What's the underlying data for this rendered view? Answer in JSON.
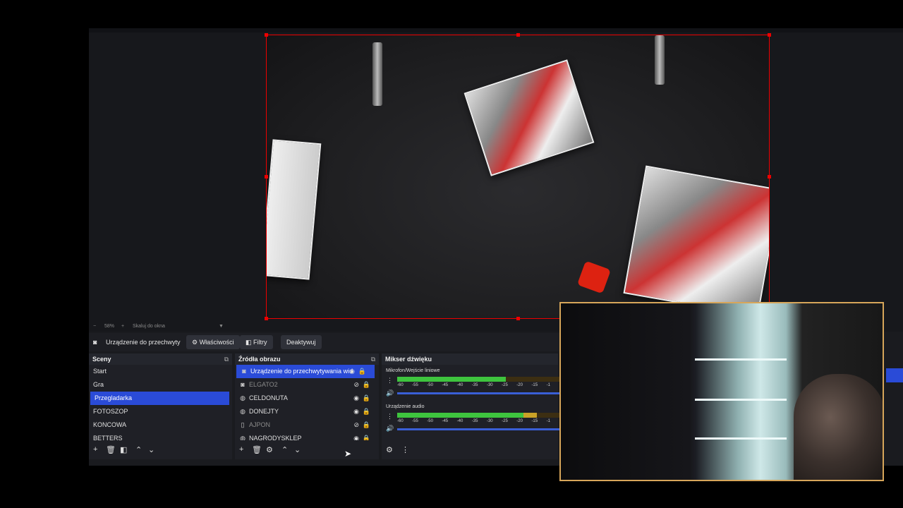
{
  "preview": {
    "zoom": "58%",
    "fit_label": "Skaluj do okna"
  },
  "source_toolbar": {
    "selected_source": "Urządzenie do przechwyty",
    "properties_label": "Właściwości",
    "filters_label": "Filtry",
    "deactivate_label": "Deaktywuj"
  },
  "scenes": {
    "title": "Sceny",
    "items": [
      "Start",
      "Gra",
      "Przegladarka",
      "FOTOSZOP",
      "KONCOWA",
      "BETTERS"
    ],
    "selected": "Przegladarka"
  },
  "sources": {
    "title": "Źródła obrazu",
    "items": [
      {
        "label": "Urządzenie do przechwytywania wid",
        "icon": "camera-icon",
        "visible": true,
        "selected": true
      },
      {
        "label": "ELGATO2",
        "icon": "camera-icon",
        "visible": false,
        "selected": false
      },
      {
        "label": "CELDONUTA",
        "icon": "globe-icon",
        "visible": true,
        "selected": false
      },
      {
        "label": "DONEJTY",
        "icon": "globe-icon",
        "visible": true,
        "selected": false
      },
      {
        "label": "AJPON",
        "icon": "file-icon",
        "visible": false,
        "selected": false
      },
      {
        "label": "NAGRODYSKLEP",
        "icon": "globe-icon",
        "visible": true,
        "selected": false
      }
    ]
  },
  "mixer": {
    "title": "Mikser dźwięku",
    "channels": [
      {
        "label": "Mikrofon/Wejście liniowe",
        "level_fraction": 0.67
      },
      {
        "label": "Urządzenie audio",
        "level_fraction": 0.86
      }
    ],
    "ticks": [
      "-60",
      "-55",
      "-50",
      "-45",
      "-40",
      "-35",
      "-30",
      "-25",
      "-20",
      "-15",
      "-1"
    ]
  },
  "colors": {
    "accent": "#2a4bd7",
    "selection_border": "#ee0000",
    "webcam_border": "#d7a65a"
  }
}
